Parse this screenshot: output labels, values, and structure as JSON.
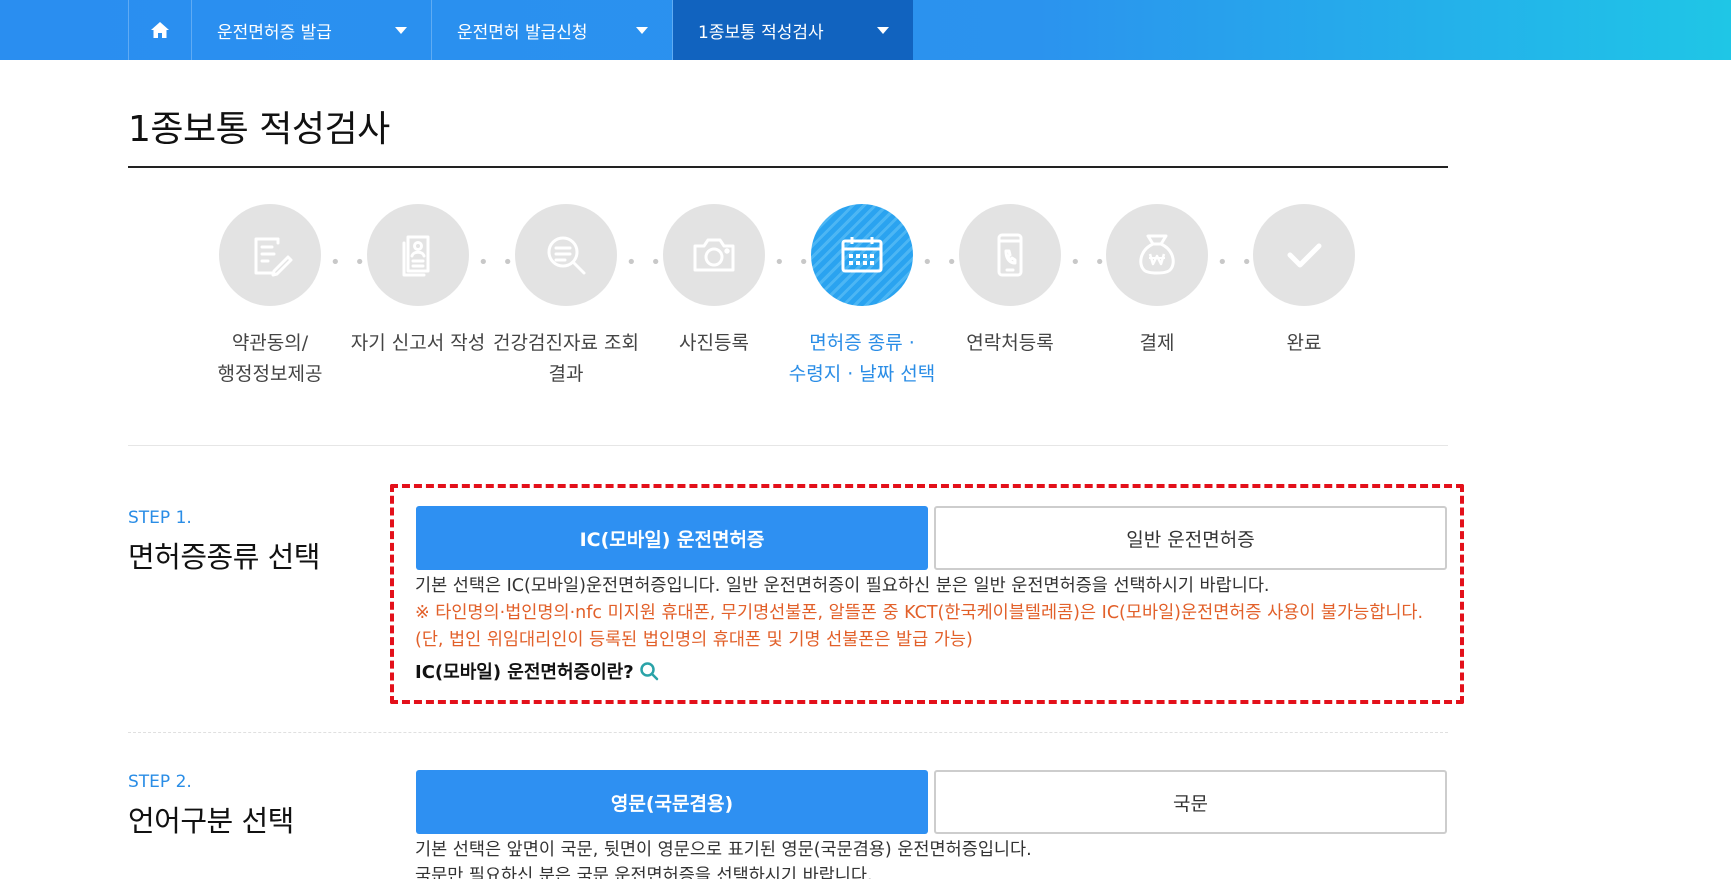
{
  "nav": {
    "items": [
      {
        "label": "운전면허증 발급"
      },
      {
        "label": "운전면허 발급신청"
      },
      {
        "label": "1종보통 적성검사"
      }
    ]
  },
  "page": {
    "title": "1종보통 적성검사"
  },
  "stepper": {
    "steps": [
      {
        "label": "약관동의/\n행정정보제공",
        "icon": "document-sign-icon"
      },
      {
        "label": "자기 신고서 작성",
        "icon": "self-report-icon"
      },
      {
        "label": "건강검진자료 조회\n결과",
        "icon": "magnifier-document-icon"
      },
      {
        "label": "사진등록",
        "icon": "camera-icon"
      },
      {
        "label": "면허증 종류 ·\n수령지 · 날짜 선택",
        "icon": "calendar-icon",
        "active": true
      },
      {
        "label": "연락처등록",
        "icon": "phone-icon"
      },
      {
        "label": "결제",
        "icon": "money-bag-icon"
      },
      {
        "label": "완료",
        "icon": "check-icon"
      }
    ],
    "separator": "• •"
  },
  "step1": {
    "tag": "STEP 1.",
    "title": "면허증종류 선택",
    "option_selected": "IC(모바일) 운전면허증",
    "option_other": "일반 운전면허증",
    "desc": "기본 선택은 IC(모바일)운전면허증입니다. 일반 운전면허증이 필요하신 분은 일반 운전면허증을 선택하시기 바랍니다.",
    "warning1": "※ 타인명의·법인명의·nfc 미지원 휴대폰, 무기명선불폰, 알뜰폰 중 KCT(한국케이블텔레콤)은 IC(모바일)운전면허증 사용이 불가능합니다.",
    "warning2": "(단, 법인 위임대리인이 등록된 법인명의 휴대폰 및 기명 선불폰은 발급 가능)",
    "link": "IC(모바일) 운전면허증이란?"
  },
  "step2": {
    "tag": "STEP 2.",
    "title": "언어구분 선택",
    "option_selected": "영문(국문겸용)",
    "option_other": "국문",
    "desc": "기본 선택은 앞면이 국문, 뒷면이 영문으로 표기된 영문(국문겸용) 운전면허증입니다.",
    "desc2": "국문만 필요하신 분은 국문 운전면허증을 선택하시기 바랍니다."
  },
  "colors": {
    "accent": "#2e90f2",
    "active_nav": "#1163bf",
    "warning": "#e2602a",
    "highlight_border": "#e3101a"
  }
}
